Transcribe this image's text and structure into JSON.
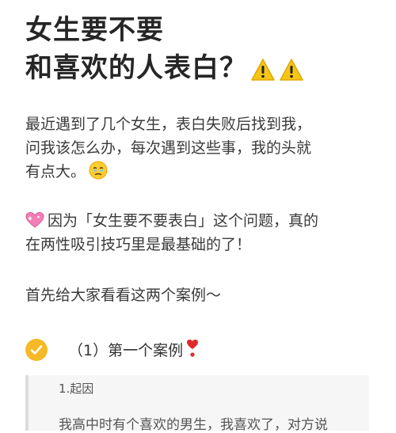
{
  "title": {
    "line1": "女生要不要",
    "line2": "和喜欢的人表白？",
    "icons": [
      "warning-icon",
      "warning-icon"
    ]
  },
  "intro": {
    "line1": "最近遇到了几个女生，表白失败后找到我，",
    "line2": "问我该怎么办，每次遇到这些事，我的头就",
    "line3": "有点大。",
    "emoji": "holding-back-tears-icon"
  },
  "point": {
    "icon": "sparkling-heart-icon",
    "line1": "因为「女生要不要表白」这个问题，真的",
    "line2": "在两性吸引技巧里是最基础的了！"
  },
  "lead": {
    "text": "首先给大家看看这两个案例～"
  },
  "section": {
    "label": "（1）第一个案例",
    "icons": [
      "check-icon",
      "heart-exclamation-icon"
    ]
  },
  "quote": {
    "heading": "1.起因",
    "partial": "我高中时有个喜欢的男生，我喜欢了，对方说"
  },
  "colors": {
    "accent_yellow": "#f6b927",
    "warning_yellow": "#f5c518",
    "heart_pink": "#f27fb6",
    "heart_red": "#e02a2a",
    "quote_bg": "#f6f6f6"
  }
}
